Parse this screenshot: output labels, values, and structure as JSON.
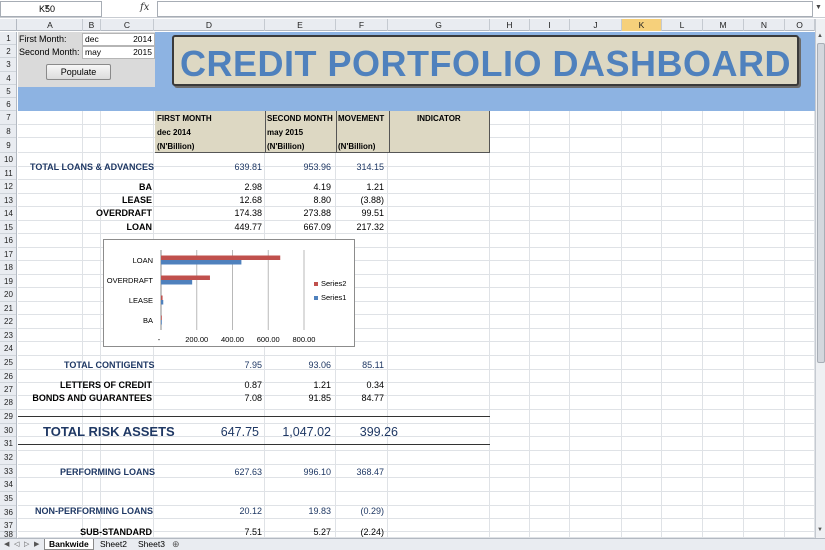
{
  "formula_bar": {
    "name_box": "K50",
    "fx": "fx",
    "formula": ""
  },
  "columns": [
    {
      "label": "A",
      "x": 18,
      "w": 65
    },
    {
      "label": "B",
      "x": 83,
      "w": 18
    },
    {
      "label": "C",
      "x": 101,
      "w": 53
    },
    {
      "label": "D",
      "x": 154,
      "w": 111
    },
    {
      "label": "E",
      "x": 265,
      "w": 71
    },
    {
      "label": "F",
      "x": 336,
      "w": 52
    },
    {
      "label": "G",
      "x": 388,
      "w": 102
    },
    {
      "label": "H",
      "x": 490,
      "w": 40
    },
    {
      "label": "I",
      "x": 530,
      "w": 40
    },
    {
      "label": "J",
      "x": 570,
      "w": 52
    },
    {
      "label": "K",
      "x": 622,
      "w": 40
    },
    {
      "label": "L",
      "x": 662,
      "w": 41
    },
    {
      "label": "M",
      "x": 703,
      "w": 41
    },
    {
      "label": "N",
      "x": 744,
      "w": 41
    },
    {
      "label": "O",
      "x": 785,
      "w": 30
    }
  ],
  "selected_column": "K",
  "params": {
    "first_label": "First Month:",
    "first_month": "dec",
    "first_year": "2014",
    "second_label": "Second Month:",
    "second_month": "may",
    "second_year": "2015",
    "populate": "Populate"
  },
  "title": "CREDIT PORTFOLIO DASHBOARD",
  "headers": {
    "first_month": "FIRST MONTH",
    "first_period": "dec 2014",
    "first_unit": "(N'Billion)",
    "second_month": "SECOND MONTH",
    "second_period": "may 2015",
    "second_unit": "(N'Billion)",
    "movement": "MOVEMENT",
    "movement_unit": "(N'Billion)",
    "indicator": "INDICATOR"
  },
  "rows": {
    "total_loans": {
      "label": "TOTAL LOANS & ADVANCES",
      "a": "639.81",
      "b": "953.96",
      "c": "314.15"
    },
    "ba": {
      "label": "BA",
      "a": "2.98",
      "b": "4.19",
      "c": "1.21"
    },
    "lease": {
      "label": "LEASE",
      "a": "12.68",
      "b": "8.80",
      "c": "(3.88)"
    },
    "overdraft": {
      "label": "OVERDRAFT",
      "a": "174.38",
      "b": "273.88",
      "c": "99.51"
    },
    "loan": {
      "label": "LOAN",
      "a": "449.77",
      "b": "667.09",
      "c": "217.32"
    },
    "total_contigents": {
      "label": "TOTAL CONTIGENTS",
      "a": "7.95",
      "b": "93.06",
      "c": "85.11"
    },
    "letters_of_credit": {
      "label": "LETTERS OF CREDIT",
      "a": "0.87",
      "b": "1.21",
      "c": "0.34"
    },
    "bonds": {
      "label": "BONDS AND GUARANTEES",
      "a": "7.08",
      "b": "91.85",
      "c": "84.77"
    },
    "total_risk": {
      "label": "TOTAL RISK ASSETS",
      "a": "647.75",
      "b": "1,047.02",
      "c": "399.26"
    },
    "performing": {
      "label": "PERFORMING LOANS",
      "a": "627.63",
      "b": "996.10",
      "c": "368.47"
    },
    "non_performing": {
      "label": "NON-PERFORMING LOANS",
      "a": "20.12",
      "b": "19.83",
      "c": "(0.29)"
    },
    "sub_standard": {
      "label": "SUB-STANDARD",
      "a": "7.51",
      "b": "5.27",
      "c": "(2.24)"
    }
  },
  "chart_data": {
    "type": "bar",
    "orientation": "horizontal",
    "categories": [
      "BA",
      "LEASE",
      "OVERDRAFT",
      "LOAN"
    ],
    "series": [
      {
        "name": "Series1",
        "values": [
          2.98,
          12.68,
          174.38,
          449.77
        ],
        "color": "#4f81bd"
      },
      {
        "name": "Series2",
        "values": [
          4.19,
          8.8,
          273.88,
          667.09
        ],
        "color": "#c0504d"
      }
    ],
    "xlim": [
      0,
      800
    ],
    "xticks": [
      "-",
      "200.00",
      "400.00",
      "600.00",
      "800.00"
    ],
    "grid": true,
    "legend": "right"
  },
  "sheets": [
    "Bankwide",
    "Sheet2",
    "Sheet3"
  ],
  "active_sheet": "Bankwide"
}
